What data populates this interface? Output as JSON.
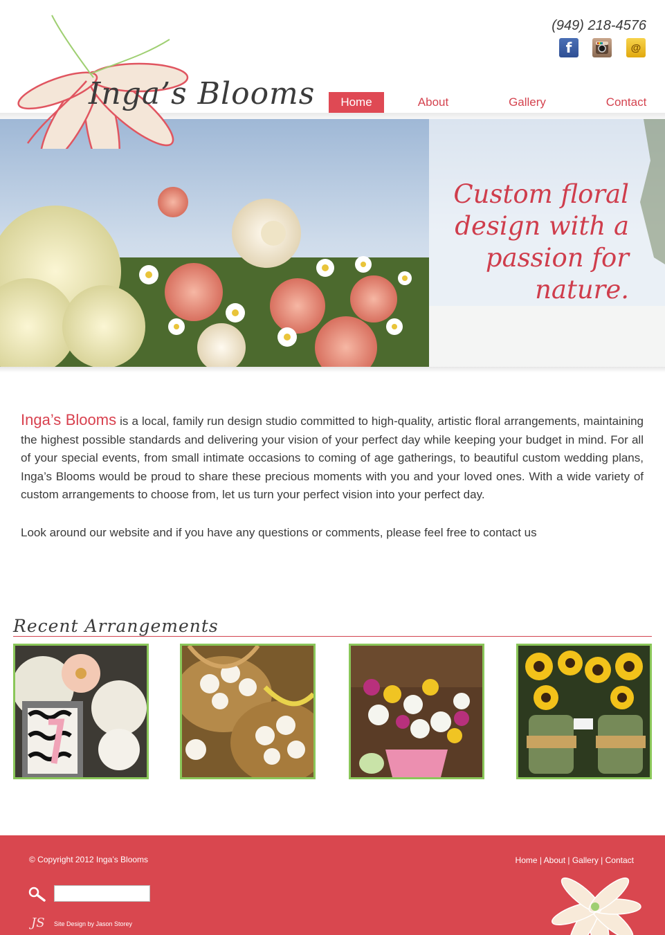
{
  "header": {
    "brand": "Inga’s Blooms",
    "phone": "(949) 218-4576",
    "social": [
      {
        "name": "facebook-icon",
        "glyph": "f"
      },
      {
        "name": "instagram-icon",
        "glyph": ""
      },
      {
        "name": "email-icon",
        "glyph": "@"
      }
    ],
    "nav": [
      {
        "label": "Home",
        "active": true
      },
      {
        "label": "About",
        "active": false
      },
      {
        "label": "Gallery",
        "active": false
      },
      {
        "label": "Contact",
        "active": false
      }
    ]
  },
  "hero": {
    "tagline_lines": [
      "Custom floral",
      "design with a",
      "passion for",
      "nature."
    ]
  },
  "intro": {
    "brand": "Inga’s Blooms",
    "body": " is a local, family run design studio committed to high-quality, artistic floral arrangements, maintaining the highest possible standards and delivering your vision of your perfect day while keeping your budget in mind. For all of your special events, from small intimate occasions to coming of age gatherings, to beautiful custom wedding plans, Inga’s Blooms would be proud to share these precious moments with you and your loved ones. With a wide variety of custom arrangements to choose from, let us turn your perfect vision into your perfect day.",
    "closing": "Look around our website and if you have any questions or comments, please feel free to contact us"
  },
  "recent": {
    "title": "Recent Arrangements",
    "items": [
      {
        "name": "arrangement-table-number"
      },
      {
        "name": "arrangement-petal-baskets"
      },
      {
        "name": "arrangement-pink-pail-daisies"
      },
      {
        "name": "arrangement-sunflower-jars"
      }
    ]
  },
  "footer": {
    "copyright": "© Copyright 2012 Inga’s Blooms",
    "links": [
      "Home",
      "About",
      "Gallery",
      "Contact"
    ],
    "search_value": "",
    "designer_mark": "JS",
    "designer_credit": "Site Design by Jason Storey"
  },
  "colors": {
    "brand_red": "#df4954",
    "footer_red": "#d9474f",
    "thumb_border": "#8ac659",
    "text": "#3a3a3a"
  }
}
